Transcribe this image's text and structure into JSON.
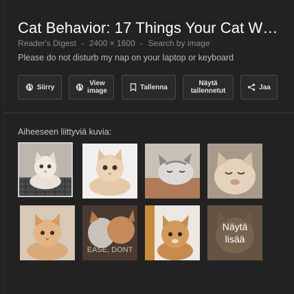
{
  "result": {
    "title": "Cat Behavior: 17 Things Your Cat W…",
    "source": "Reader's Digest",
    "dimensions": "2400 × 1600",
    "search_by_image": "Search by image",
    "separator": "-",
    "description": "Please do not disturb my nap on your laptop or keyboard"
  },
  "actions": {
    "visit": "Siirry",
    "view_image": "View\nimage",
    "save": "Tallenna",
    "view_saved": "Näytä\ntallennetut",
    "share": "Jaa"
  },
  "related": {
    "label": "Aiheeseen liittyviä kuvia:",
    "more_label": "Näytä\nlisää"
  },
  "icons": {
    "visit": "globe-icon",
    "view_image": "globe-icon",
    "save": "bookmark-icon",
    "view_saved": "none",
    "share": "share-icon"
  },
  "colors": {
    "background": "#222222",
    "title": "#ffffff",
    "button_border": "#4a4a4a"
  }
}
